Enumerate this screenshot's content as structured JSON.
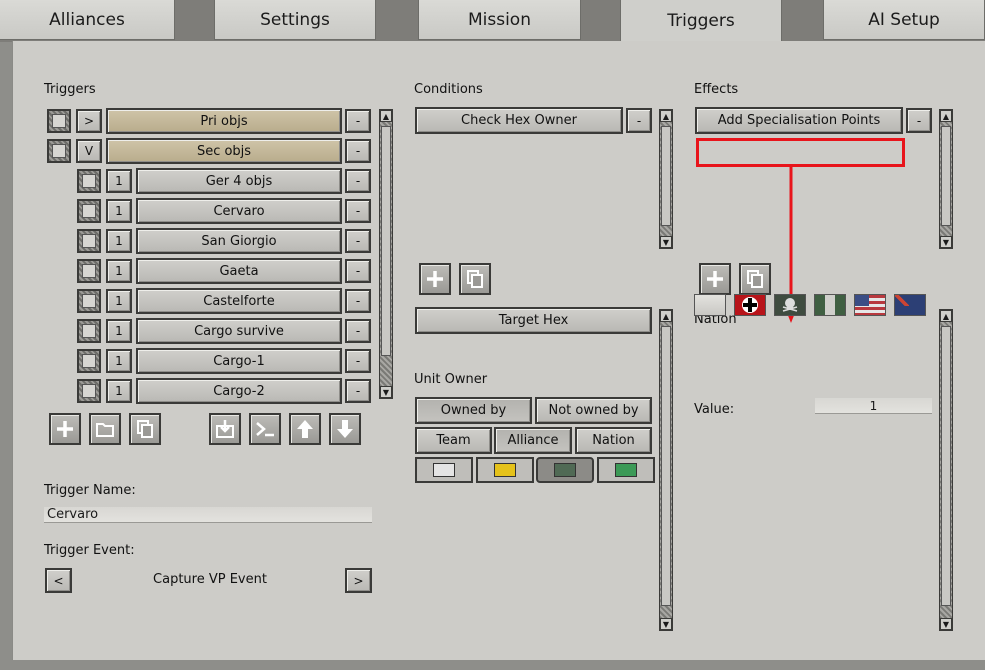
{
  "tabs": [
    "Alliances",
    "Settings",
    "Mission",
    "Triggers",
    "AI Setup"
  ],
  "triggers": {
    "heading": "Triggers",
    "groups": [
      {
        "toggle": ">",
        "label": "Pri objs"
      },
      {
        "toggle": "V",
        "label": "Sec objs"
      }
    ],
    "items": [
      {
        "num": "1",
        "label": "Ger 4 objs"
      },
      {
        "num": "1",
        "label": "Cervaro"
      },
      {
        "num": "1",
        "label": "San Giorgio"
      },
      {
        "num": "1",
        "label": "Gaeta"
      },
      {
        "num": "1",
        "label": "Castelforte"
      },
      {
        "num": "1",
        "label": "Cargo survive"
      },
      {
        "num": "1",
        "label": "Cargo-1"
      },
      {
        "num": "1",
        "label": "Cargo-2"
      }
    ],
    "remove_label": "-",
    "toolbar_icons": [
      "add-icon",
      "folder-icon",
      "copy-icon",
      "import-icon",
      "console-icon",
      "arrow-up-icon",
      "arrow-down-icon"
    ],
    "name_label": "Trigger Name:",
    "name_value": "Cervaro",
    "event_label": "Trigger Event:",
    "event_value": "Capture VP Event",
    "event_prev": "<",
    "event_next": ">"
  },
  "conditions": {
    "heading": "Conditions",
    "items": [
      "Check Hex Owner"
    ],
    "remove_label": "-",
    "target_hex": "Target Hex",
    "unit_owner_label": "Unit Owner",
    "owned_by": "Owned by",
    "not_owned_by": "Not owned by",
    "team": "Team",
    "alliance": "Alliance",
    "nation": "Nation",
    "alliance_colors": [
      "#e4e4e4",
      "#e5c21a",
      "#506a55",
      "#3c9a57"
    ],
    "selected_color_index": 2
  },
  "effects": {
    "heading": "Effects",
    "items": [
      "Add Specialisation Points"
    ],
    "remove_label": "-",
    "nation_label": "Nation",
    "value_label": "Value:",
    "value": "1",
    "flags": [
      "blank-flag",
      "german-cross-flag",
      "skull-flag",
      "italian-flag",
      "us-flag",
      "new-zealand-flag"
    ]
  },
  "highlight_color": "#e8141b"
}
